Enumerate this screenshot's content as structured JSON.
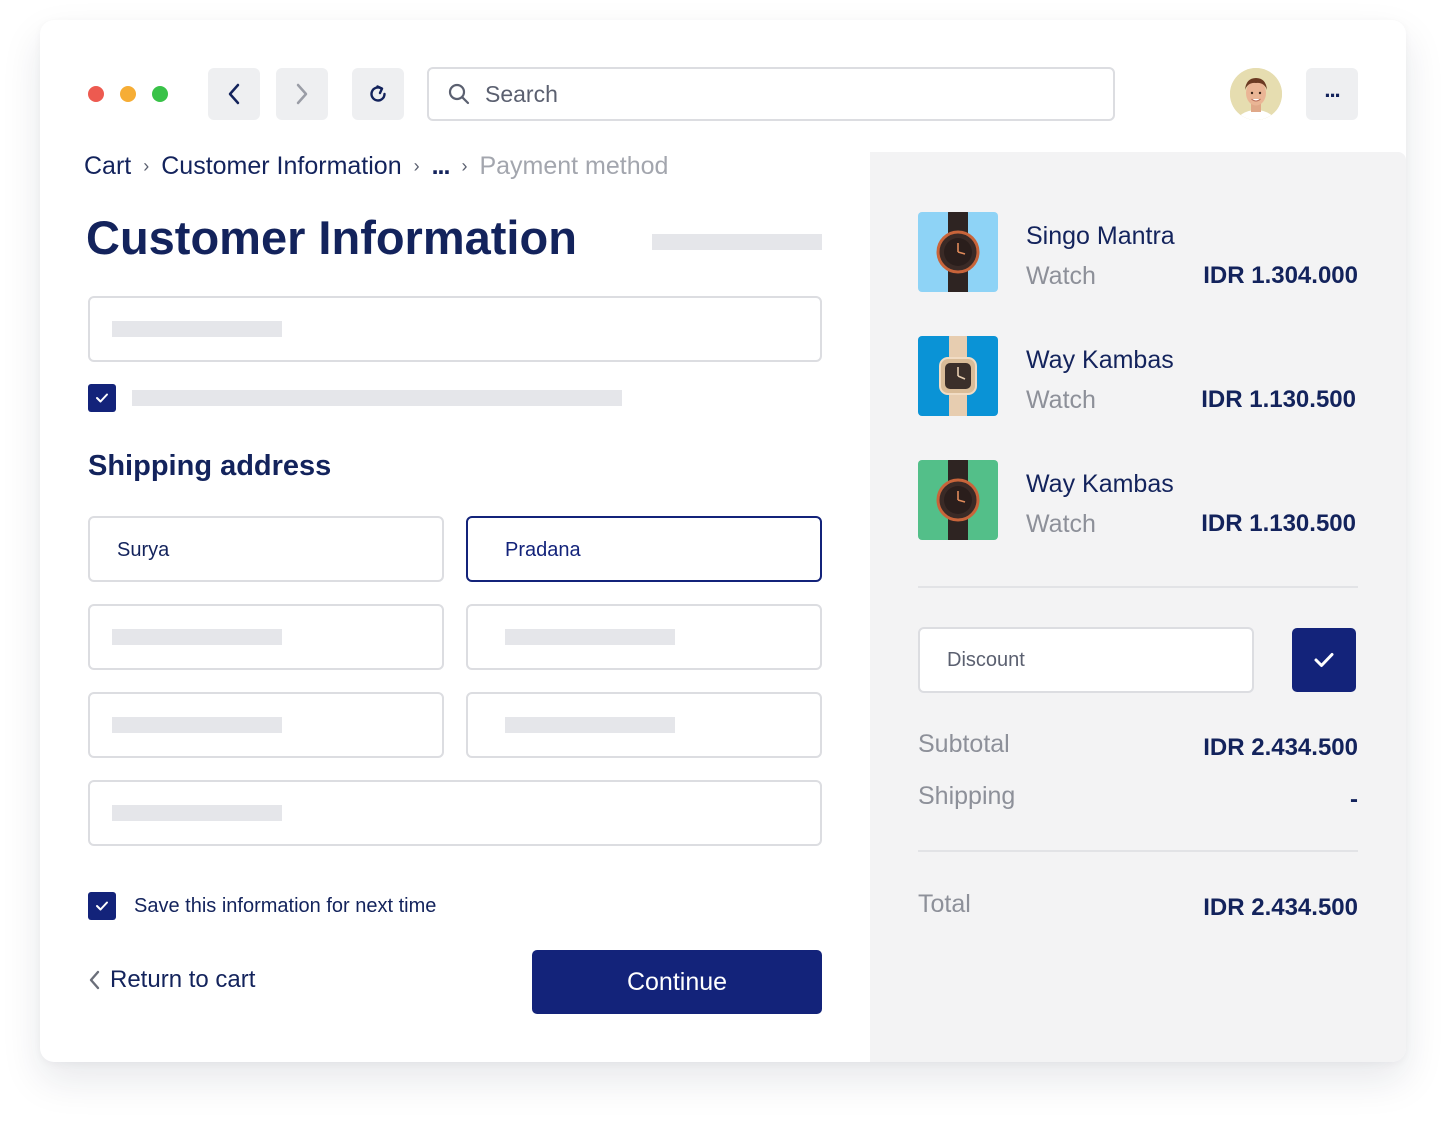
{
  "toolbar": {
    "search_placeholder": "Search",
    "window_dots": [
      "#ed5a50",
      "#f6ad35",
      "#39c248"
    ],
    "icons": {
      "back": "chevron-left-icon",
      "forward": "chevron-right-icon",
      "reload": "reload-icon",
      "search": "search-icon",
      "more": "more-icon"
    },
    "more_label": "..."
  },
  "breadcrumb": {
    "items": [
      "Cart",
      "Customer Information",
      "...",
      "Payment method"
    ],
    "current_index": 3
  },
  "form": {
    "title": "Customer Information",
    "shipping_title": "Shipping address",
    "first_name": "Surya",
    "last_name": "Pradana",
    "save_info_label": "Save this information for next time",
    "save_info_checked": true,
    "newsletter_checked": true
  },
  "actions": {
    "return_label": "Return to cart",
    "continue_label": "Continue"
  },
  "cart": {
    "items": [
      {
        "name": "Singo Mantra",
        "category": "Watch",
        "price": "IDR 1.304.000",
        "thumb_color": "#8ed3f6"
      },
      {
        "name": "Way Kambas",
        "category": "Watch",
        "price": "IDR 1.130.500",
        "thumb_color": "#0a93d6"
      },
      {
        "name": "Way Kambas",
        "category": "Watch",
        "price": "IDR 1.130.500",
        "thumb_color": "#53bf89"
      }
    ],
    "discount_placeholder": "Discount",
    "subtotal_label": "Subtotal",
    "subtotal_value": "IDR 2.434.500",
    "shipping_label": "Shipping",
    "shipping_value": "-",
    "total_label": "Total",
    "total_value": "IDR 2.434.500"
  },
  "colors": {
    "primary": "#13237a",
    "text": "#13235c",
    "muted": "#8d9099",
    "panel": "#f3f3f4"
  }
}
